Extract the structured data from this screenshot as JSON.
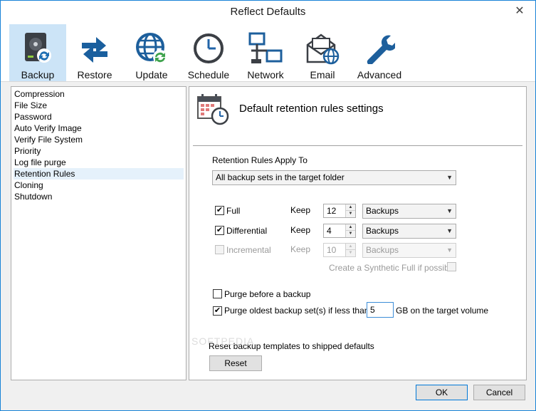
{
  "window": {
    "title": "Reflect Defaults",
    "close_glyph": "✕"
  },
  "toolbar": [
    {
      "label": "Backup",
      "icon": "backup-icon",
      "active": true
    },
    {
      "label": "Restore",
      "icon": "restore-icon"
    },
    {
      "label": "Update",
      "icon": "update-icon"
    },
    {
      "label": "Schedule",
      "icon": "clock-icon"
    },
    {
      "label": "Network",
      "icon": "network-icon"
    },
    {
      "label": "Email",
      "icon": "email-icon"
    },
    {
      "label": "Advanced",
      "icon": "wrench-icon"
    }
  ],
  "sidebar": {
    "items": [
      "Compression",
      "File Size",
      "Password",
      "Auto Verify Image",
      "Verify File System",
      "Priority",
      "Log file purge",
      "Retention Rules",
      "Cloning",
      "Shutdown"
    ],
    "selected": "Retention Rules"
  },
  "panel": {
    "title": "Default retention rules settings",
    "apply_label": "Retention Rules Apply To",
    "apply_value": "All backup sets in the target folder",
    "rules": [
      {
        "label": "Full",
        "checked": true,
        "enabled": true,
        "keep_label": "Keep",
        "keep_value": "12",
        "unit": "Backups"
      },
      {
        "label": "Differential",
        "checked": true,
        "enabled": true,
        "keep_label": "Keep",
        "keep_value": "4",
        "unit": "Backups"
      },
      {
        "label": "Incremental",
        "checked": false,
        "enabled": false,
        "keep_label": "Keep",
        "keep_value": "10",
        "unit": "Backups"
      }
    ],
    "synthetic_label": "Create a Synthetic Full if possible",
    "purge_before_label": "Purge before a backup",
    "purge_before_checked": false,
    "purge_oldest_label": "Purge oldest backup set(s) if less than",
    "purge_oldest_checked": true,
    "purge_oldest_value": "5",
    "purge_oldest_suffix": "GB on the target volume",
    "reset_label": "Reset backup templates to shipped defaults",
    "reset_button": "Reset",
    "watermark": "SOFTPEDIA"
  },
  "footer": {
    "ok": "OK",
    "cancel": "Cancel"
  },
  "colors": {
    "accent": "#0078d7",
    "active_tab": "#cce4f7",
    "selected_item": "#e5f1fb"
  }
}
